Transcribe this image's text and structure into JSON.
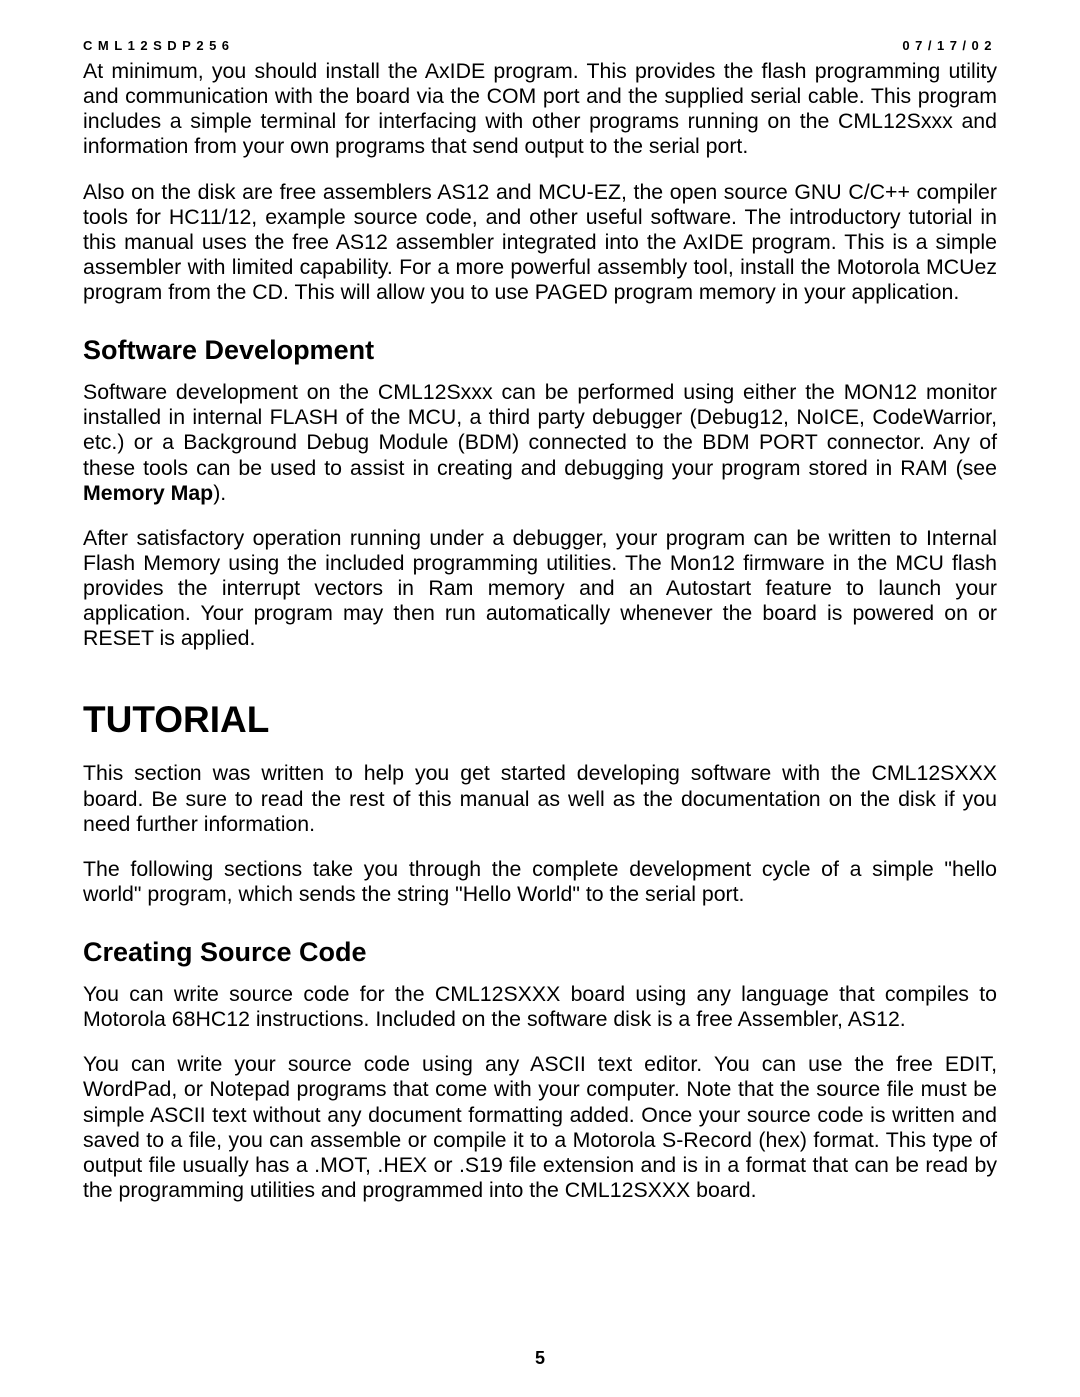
{
  "header": {
    "left": "CML12SDP256",
    "right": "07/17/02"
  },
  "p1": "At minimum, you should install the AxIDE program.  This provides the flash programming utility and communication with the board via the COM port and the supplied serial cable.  This program includes a simple terminal for interfacing with other programs running on the CML12Sxxx and information from your own programs that send output to the serial port.",
  "p2": "Also on the disk are free assemblers AS12 and MCU-EZ, the open source GNU C/C++ compiler tools for HC11/12, example source code, and other useful software.  The introductory tutorial in this manual uses the free AS12 assembler integrated into the AxIDE program.  This is a simple assembler with limited capability.  For a more powerful assembly tool, install the Motorola MCUez program from the CD.  This will allow you to use PAGED program memory in your application.",
  "h2_1": "Software Development",
  "p3a": "Software development on the CML12Sxxx can be performed using either the MON12 monitor installed in internal FLASH of the MCU, a third party debugger (Debug12, NoICE, CodeWarrior, etc.) or a Background Debug Module (BDM) connected to the BDM PORT connector.  Any of these tools can be used to assist in creating and debugging your program stored in RAM (see ",
  "p3b": "Memory Map",
  "p3c": ").",
  "p4": "After satisfactory operation running under a debugger, your program can be written to Internal Flash Memory using the included programming utilities.  The Mon12 firmware in the MCU flash provides the interrupt vectors in Ram memory and an Autostart feature to launch your application.  Your program may then run automatically whenever the board is powered on or RESET is applied.",
  "h1": "TUTORIAL",
  "p5": "This section was written to help you get started developing software with the CML12SXXX board.  Be sure to read the rest of this manual as well as the documentation on the disk if you need further information.",
  "p6": "The following sections take you through the complete development cycle of a simple \"hello world\" program, which sends the string \"Hello World\" to the serial port.",
  "h2_2": "Creating Source Code",
  "p7": "You can write source code for the CML12SXXX board using any language that compiles to Motorola 68HC12 instructions.  Included on the software disk is a free Assembler, AS12.",
  "p8": "You can write your source code using any ASCII text editor. You can use the free EDIT, WordPad, or Notepad programs that come with your computer. Note that the source file must be simple ASCII text without any document formatting added. Once your source code is written and saved to a file, you can assemble or compile it to a Motorola S-Record (hex) format.  This type of output file usually has a .MOT, .HEX or .S19 file extension and is in a format that can be read by the programming utilities and programmed into the CML12SXXX board.",
  "page_number": "5"
}
